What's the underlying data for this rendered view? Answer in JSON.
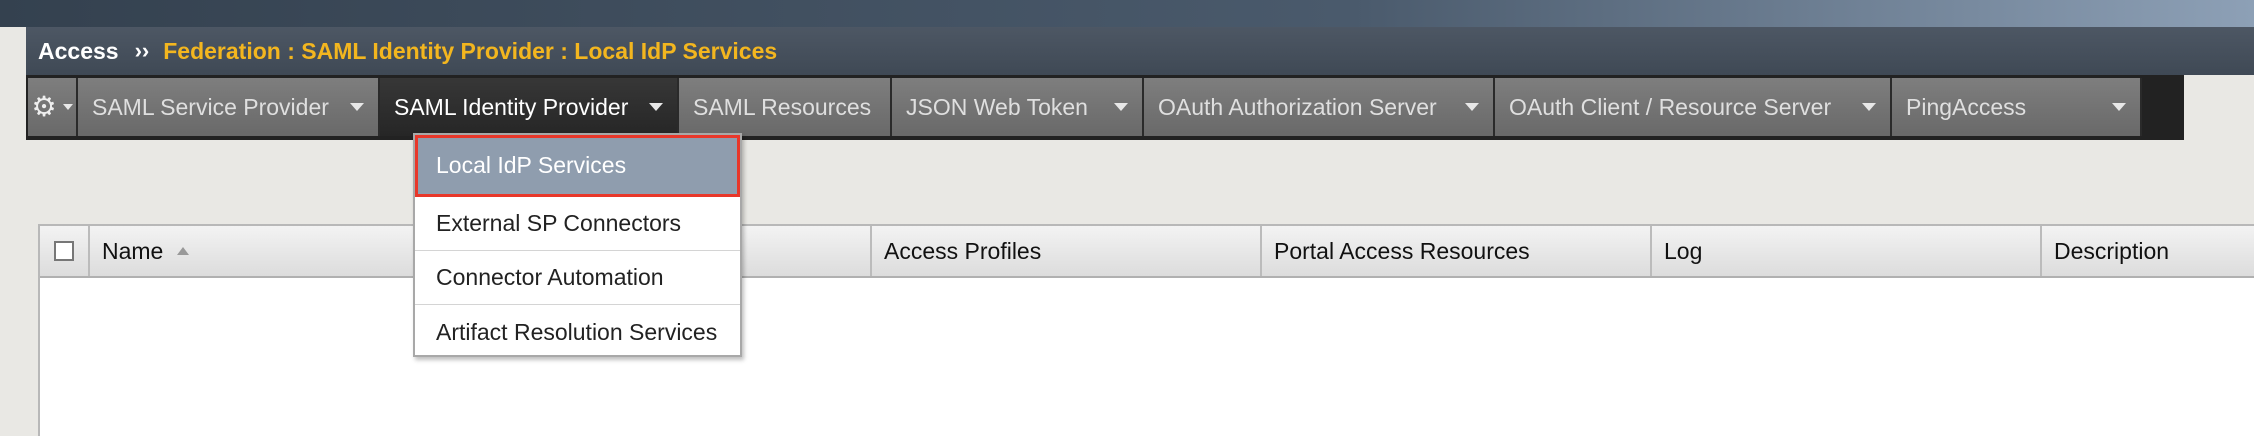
{
  "breadcrumb": {
    "root": "Access",
    "separator": "››",
    "path": "Federation : SAML Identity Provider : Local IdP Services"
  },
  "nav": {
    "gear_icon": "gear-icon",
    "items": [
      {
        "label": "SAML Service Provider",
        "has_menu": true
      },
      {
        "label": "SAML Identity Provider",
        "has_menu": true,
        "active": true
      },
      {
        "label": "SAML Resources",
        "has_menu": false
      },
      {
        "label": "JSON Web Token",
        "has_menu": true
      },
      {
        "label": "OAuth Authorization Server",
        "has_menu": true
      },
      {
        "label": "OAuth Client / Resource Server",
        "has_menu": true
      },
      {
        "label": "PingAccess",
        "has_menu": true
      }
    ]
  },
  "dropdown": {
    "items": [
      {
        "label": "Local IdP Services",
        "selected": true
      },
      {
        "label": "External SP Connectors"
      },
      {
        "label": "Connector Automation"
      },
      {
        "label": "Artifact Resolution Services"
      }
    ]
  },
  "table": {
    "columns": [
      "Name",
      "",
      "Access Profiles",
      "Portal Access Resources",
      "Log",
      "Description"
    ]
  },
  "colors": {
    "breadcrumb_path": "#f3b61f",
    "highlight_outline": "#e8372a",
    "selected_bg": "#8f9dae"
  }
}
